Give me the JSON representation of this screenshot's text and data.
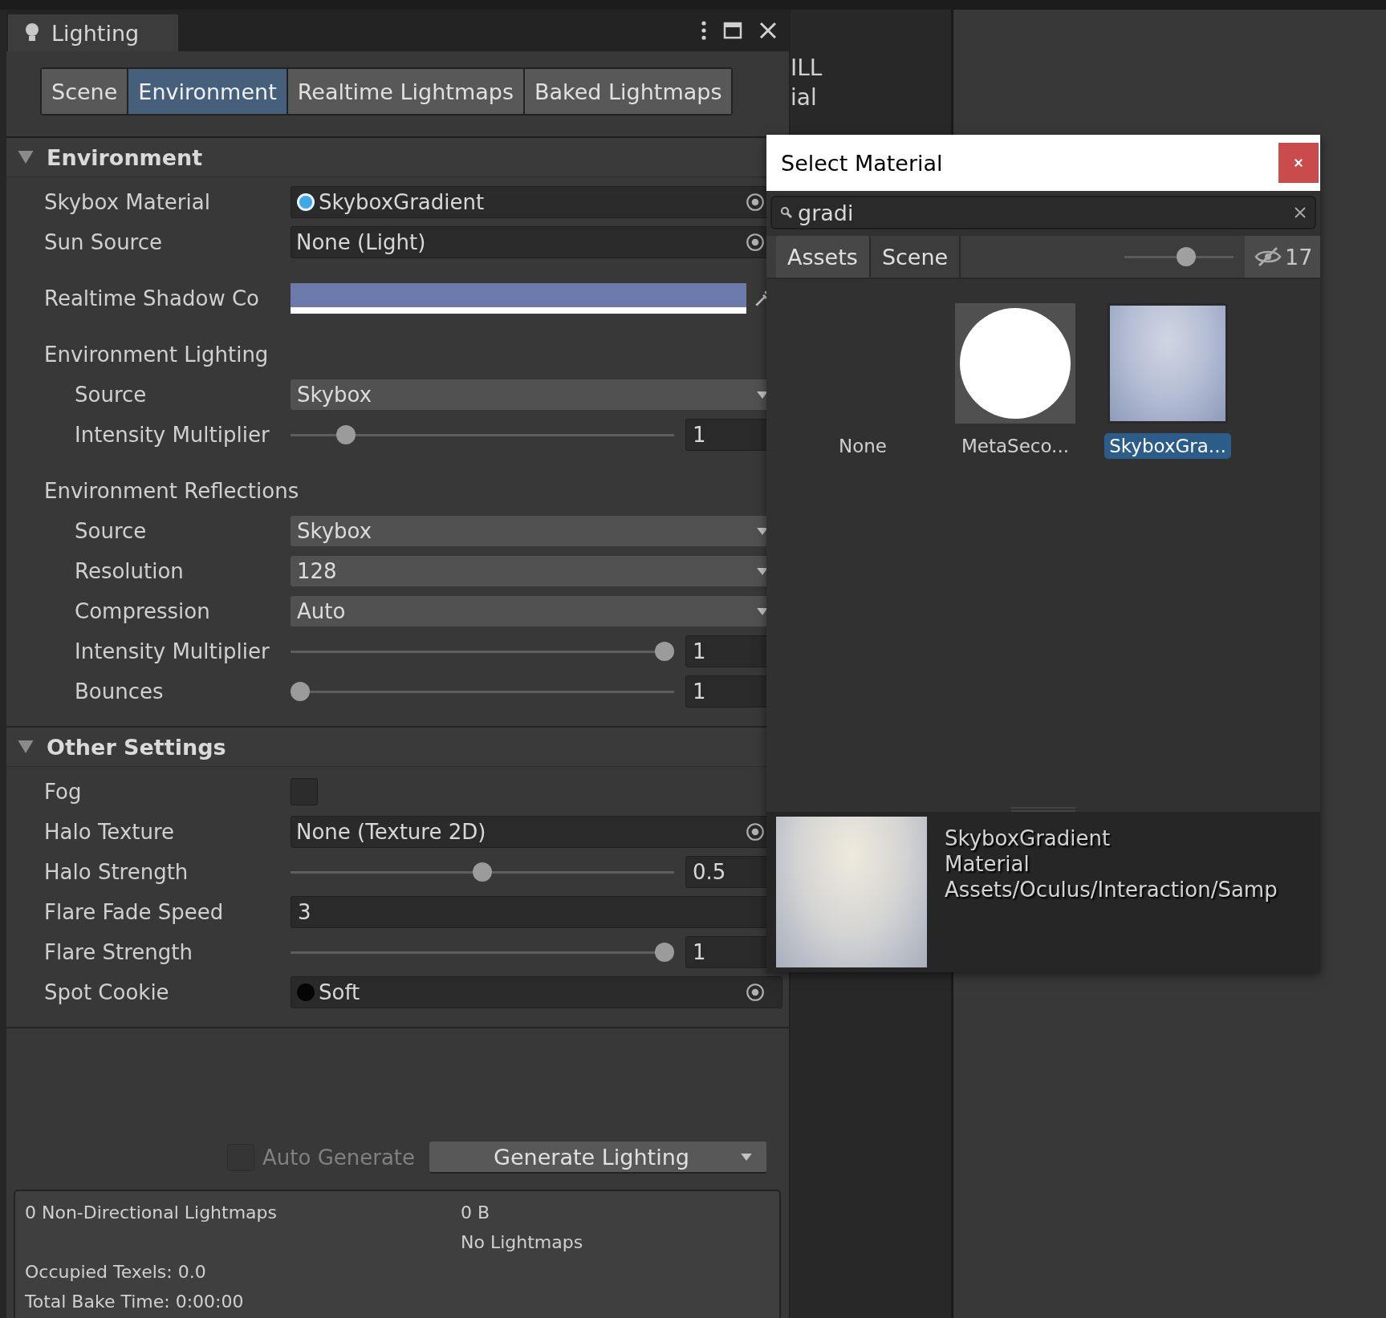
{
  "window": {
    "title": "Lighting"
  },
  "tabs": [
    {
      "label": "Scene",
      "selected": false
    },
    {
      "label": "Environment",
      "selected": true
    },
    {
      "label": "Realtime Lightmaps",
      "selected": false
    },
    {
      "label": "Baked Lightmaps",
      "selected": false
    }
  ],
  "sections": [
    {
      "title": "Environment",
      "expanded": true,
      "rows": [
        {
          "kind": "material",
          "label": "Skybox Material",
          "value": "SkyboxGradient"
        },
        {
          "kind": "object",
          "label": "Sun Source",
          "value": "None (Light)"
        },
        {
          "kind": "color",
          "label": "Realtime Shadow Co",
          "color": "#6b7aa8"
        },
        {
          "kind": "group",
          "label": "Environment Lighting",
          "children": [
            {
              "kind": "dropdown",
              "label": "Source",
              "value": "Skybox"
            },
            {
              "kind": "slider",
              "label": "Intensity Multiplier",
              "level": 0.125,
              "value": "1"
            }
          ]
        },
        {
          "kind": "group",
          "label": "Environment Reflections",
          "children": [
            {
              "kind": "dropdown",
              "label": "Source",
              "value": "Skybox"
            },
            {
              "kind": "dropdown",
              "label": "Resolution",
              "value": "128"
            },
            {
              "kind": "dropdown",
              "label": "Compression",
              "value": "Auto"
            },
            {
              "kind": "slider",
              "label": "Intensity Multiplier",
              "level": 1,
              "value": "1"
            },
            {
              "kind": "slider",
              "label": "Bounces",
              "level": 0,
              "value": "1"
            }
          ]
        }
      ]
    },
    {
      "title": "Other Settings",
      "expanded": true,
      "rows": [
        {
          "kind": "checkbox",
          "label": "Fog",
          "checked": false
        },
        {
          "kind": "object",
          "label": "Halo Texture",
          "value": "None (Texture 2D)"
        },
        {
          "kind": "slider",
          "label": "Halo Strength",
          "level": 0.5,
          "value": "0.5"
        },
        {
          "kind": "float",
          "label": "Flare Fade Speed",
          "value": "3"
        },
        {
          "kind": "slider",
          "label": "Flare Strength",
          "level": 1,
          "value": "1"
        },
        {
          "kind": "texture",
          "label": "Spot Cookie",
          "value": "Soft"
        }
      ]
    }
  ],
  "auto_generate": {
    "label": "Auto Generate",
    "checked": false
  },
  "generate_button": "Generate Lighting",
  "stats": [
    {
      "left": "0 Non-Directional Lightmaps",
      "right": "0 B"
    },
    {
      "right": "No Lightmaps"
    },
    {
      "left": "Occupied Texels: 0.0"
    },
    {
      "left": "Total Bake Time: 0:00:00"
    }
  ],
  "background_text": [
    "ILL",
    "ial"
  ],
  "popup": {
    "title": "Select Material",
    "search": {
      "value": "gradi"
    },
    "tabs": [
      {
        "label": "Assets",
        "selected": true
      },
      {
        "label": "Scene",
        "selected": false
      }
    ],
    "zoom": {
      "level": 0.58
    },
    "hidden_count": "17",
    "items": [
      {
        "label": "None",
        "kind": "none",
        "selected": false
      },
      {
        "label": "MetaSeco...",
        "kind": "sphere",
        "selected": false
      },
      {
        "label": "SkyboxGra...",
        "kind": "gradient",
        "selected": true
      }
    ],
    "preview": {
      "name": "SkyboxGradient",
      "type": "Material",
      "path": "Assets/Oculus/Interaction/Samp"
    }
  }
}
